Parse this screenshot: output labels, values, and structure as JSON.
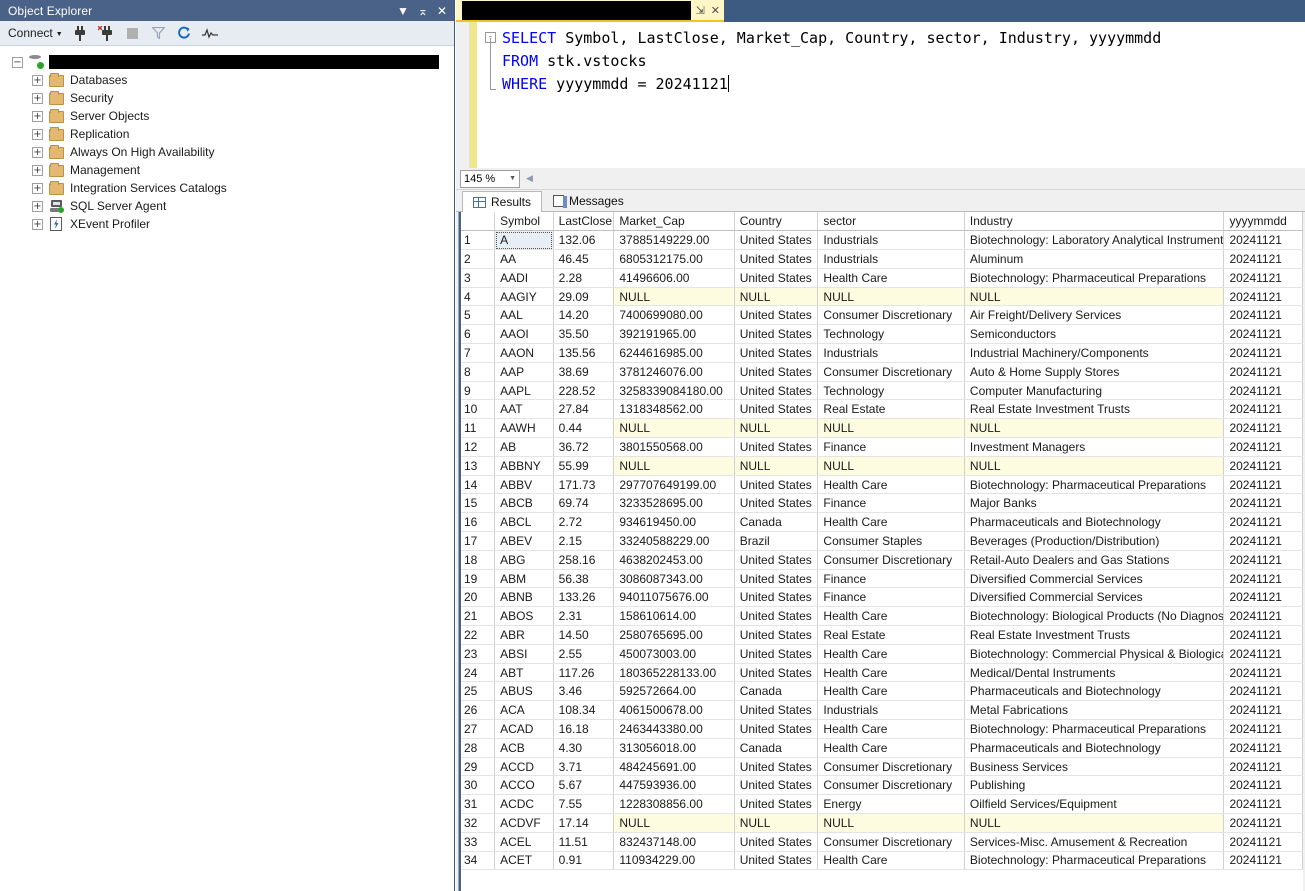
{
  "object_explorer": {
    "title": "Object Explorer",
    "window_buttons": [
      "dropdown-caret",
      "pin",
      "close"
    ],
    "toolbar": {
      "connect_label": "Connect",
      "icons": [
        "connect-plug-icon",
        "disconnect-plug-icon",
        "stop-icon",
        "filter-icon",
        "refresh-icon",
        "activity-monitor-icon"
      ]
    },
    "tree": {
      "server_label": "",
      "server_redacted": true,
      "items": [
        {
          "label": "Databases",
          "icon": "folder-icon"
        },
        {
          "label": "Security",
          "icon": "folder-icon"
        },
        {
          "label": "Server Objects",
          "icon": "folder-icon"
        },
        {
          "label": "Replication",
          "icon": "folder-icon"
        },
        {
          "label": "Always On High Availability",
          "icon": "folder-icon"
        },
        {
          "label": "Management",
          "icon": "folder-icon"
        },
        {
          "label": "Integration Services Catalogs",
          "icon": "folder-icon"
        },
        {
          "label": "SQL Server Agent",
          "icon": "sql-agent-icon"
        },
        {
          "label": "XEvent Profiler",
          "icon": "xevent-icon"
        }
      ]
    }
  },
  "editor": {
    "tab": {
      "title_redacted": true,
      "pin_label": "⇲",
      "close_label": "✕"
    },
    "query_lines": [
      {
        "collapse": "-",
        "tokens": [
          {
            "t": "SELECT",
            "k": "kw"
          },
          {
            "t": " Symbol, LastClose, Market_Cap, Country, sector, Industry, yyyymmdd",
            "k": "plain"
          }
        ]
      },
      {
        "collapse": "",
        "tokens": [
          {
            "t": "FROM",
            "k": "kw"
          },
          {
            "t": " stk.vstocks",
            "k": "plain"
          }
        ]
      },
      {
        "collapse": "",
        "tokens": [
          {
            "t": "WHERE",
            "k": "kw"
          },
          {
            "t": " yyyymmdd = ",
            "k": "plain"
          },
          {
            "t": "20241121",
            "k": "num"
          }
        ]
      }
    ],
    "zoom_level": "145 %"
  },
  "results": {
    "tabs": [
      {
        "label": "Results",
        "icon": "grid-icon",
        "active": true
      },
      {
        "label": "Messages",
        "icon": "messages-icon",
        "active": false
      }
    ],
    "columns": [
      "Symbol",
      "LastClose",
      "Market_Cap",
      "Country",
      "sector",
      "Industry",
      "yyyymmdd"
    ],
    "null_text": "NULL",
    "rows": [
      {
        "n": "1",
        "Symbol": "A",
        "LastClose": "132.06",
        "Market_Cap": "37885149229.00",
        "Country": "United States",
        "sector": "Industrials",
        "Industry": "Biotechnology: Laboratory Analytical Instruments",
        "yyyymmdd": "20241121"
      },
      {
        "n": "2",
        "Symbol": "AA",
        "LastClose": "46.45",
        "Market_Cap": "6805312175.00",
        "Country": "United States",
        "sector": "Industrials",
        "Industry": "Aluminum",
        "yyyymmdd": "20241121"
      },
      {
        "n": "3",
        "Symbol": "AADI",
        "LastClose": "2.28",
        "Market_Cap": "41496606.00",
        "Country": "United States",
        "sector": "Health Care",
        "Industry": "Biotechnology: Pharmaceutical Preparations",
        "yyyymmdd": "20241121"
      },
      {
        "n": "4",
        "Symbol": "AAGIY",
        "LastClose": "29.09",
        "Market_Cap": "NULL",
        "Country": "NULL",
        "sector": "NULL",
        "Industry": "NULL",
        "yyyymmdd": "20241121"
      },
      {
        "n": "5",
        "Symbol": "AAL",
        "LastClose": "14.20",
        "Market_Cap": "7400699080.00",
        "Country": "United States",
        "sector": "Consumer Discretionary",
        "Industry": "Air Freight/Delivery Services",
        "yyyymmdd": "20241121"
      },
      {
        "n": "6",
        "Symbol": "AAOI",
        "LastClose": "35.50",
        "Market_Cap": "392191965.00",
        "Country": "United States",
        "sector": "Technology",
        "Industry": "Semiconductors",
        "yyyymmdd": "20241121"
      },
      {
        "n": "7",
        "Symbol": "AAON",
        "LastClose": "135.56",
        "Market_Cap": "6244616985.00",
        "Country": "United States",
        "sector": "Industrials",
        "Industry": "Industrial Machinery/Components",
        "yyyymmdd": "20241121"
      },
      {
        "n": "8",
        "Symbol": "AAP",
        "LastClose": "38.69",
        "Market_Cap": "3781246076.00",
        "Country": "United States",
        "sector": "Consumer Discretionary",
        "Industry": "Auto & Home Supply Stores",
        "yyyymmdd": "20241121"
      },
      {
        "n": "9",
        "Symbol": "AAPL",
        "LastClose": "228.52",
        "Market_Cap": "3258339084180.00",
        "Country": "United States",
        "sector": "Technology",
        "Industry": "Computer Manufacturing",
        "yyyymmdd": "20241121"
      },
      {
        "n": "10",
        "Symbol": "AAT",
        "LastClose": "27.84",
        "Market_Cap": "1318348562.00",
        "Country": "United States",
        "sector": "Real Estate",
        "Industry": "Real Estate Investment Trusts",
        "yyyymmdd": "20241121"
      },
      {
        "n": "11",
        "Symbol": "AAWH",
        "LastClose": "0.44",
        "Market_Cap": "NULL",
        "Country": "NULL",
        "sector": "NULL",
        "Industry": "NULL",
        "yyyymmdd": "20241121"
      },
      {
        "n": "12",
        "Symbol": "AB",
        "LastClose": "36.72",
        "Market_Cap": "3801550568.00",
        "Country": "United States",
        "sector": "Finance",
        "Industry": "Investment Managers",
        "yyyymmdd": "20241121"
      },
      {
        "n": "13",
        "Symbol": "ABBNY",
        "LastClose": "55.99",
        "Market_Cap": "NULL",
        "Country": "NULL",
        "sector": "NULL",
        "Industry": "NULL",
        "yyyymmdd": "20241121"
      },
      {
        "n": "14",
        "Symbol": "ABBV",
        "LastClose": "171.73",
        "Market_Cap": "297707649199.00",
        "Country": "United States",
        "sector": "Health Care",
        "Industry": "Biotechnology: Pharmaceutical Preparations",
        "yyyymmdd": "20241121"
      },
      {
        "n": "15",
        "Symbol": "ABCB",
        "LastClose": "69.74",
        "Market_Cap": "3233528695.00",
        "Country": "United States",
        "sector": "Finance",
        "Industry": "Major Banks",
        "yyyymmdd": "20241121"
      },
      {
        "n": "16",
        "Symbol": "ABCL",
        "LastClose": "2.72",
        "Market_Cap": "934619450.00",
        "Country": "Canada",
        "sector": "Health Care",
        "Industry": "Pharmaceuticals and Biotechnology",
        "yyyymmdd": "20241121"
      },
      {
        "n": "17",
        "Symbol": "ABEV",
        "LastClose": "2.15",
        "Market_Cap": "33240588229.00",
        "Country": "Brazil",
        "sector": "Consumer Staples",
        "Industry": "Beverages (Production/Distribution)",
        "yyyymmdd": "20241121"
      },
      {
        "n": "18",
        "Symbol": "ABG",
        "LastClose": "258.16",
        "Market_Cap": "4638202453.00",
        "Country": "United States",
        "sector": "Consumer Discretionary",
        "Industry": "Retail-Auto Dealers and Gas Stations",
        "yyyymmdd": "20241121"
      },
      {
        "n": "19",
        "Symbol": "ABM",
        "LastClose": "56.38",
        "Market_Cap": "3086087343.00",
        "Country": "United States",
        "sector": "Finance",
        "Industry": "Diversified Commercial Services",
        "yyyymmdd": "20241121"
      },
      {
        "n": "20",
        "Symbol": "ABNB",
        "LastClose": "133.26",
        "Market_Cap": "94011075676.00",
        "Country": "United States",
        "sector": "Finance",
        "Industry": "Diversified Commercial Services",
        "yyyymmdd": "20241121"
      },
      {
        "n": "21",
        "Symbol": "ABOS",
        "LastClose": "2.31",
        "Market_Cap": "158610614.00",
        "Country": "United States",
        "sector": "Health Care",
        "Industry": "Biotechnology: Biological Products (No Diagnosti...",
        "yyyymmdd": "20241121"
      },
      {
        "n": "22",
        "Symbol": "ABR",
        "LastClose": "14.50",
        "Market_Cap": "2580765695.00",
        "Country": "United States",
        "sector": "Real Estate",
        "Industry": "Real Estate Investment Trusts",
        "yyyymmdd": "20241121"
      },
      {
        "n": "23",
        "Symbol": "ABSI",
        "LastClose": "2.55",
        "Market_Cap": "450073003.00",
        "Country": "United States",
        "sector": "Health Care",
        "Industry": "Biotechnology: Commercial Physical & Biological ...",
        "yyyymmdd": "20241121"
      },
      {
        "n": "24",
        "Symbol": "ABT",
        "LastClose": "117.26",
        "Market_Cap": "180365228133.00",
        "Country": "United States",
        "sector": "Health Care",
        "Industry": "Medical/Dental Instruments",
        "yyyymmdd": "20241121"
      },
      {
        "n": "25",
        "Symbol": "ABUS",
        "LastClose": "3.46",
        "Market_Cap": "592572664.00",
        "Country": "Canada",
        "sector": "Health Care",
        "Industry": "Pharmaceuticals and Biotechnology",
        "yyyymmdd": "20241121"
      },
      {
        "n": "26",
        "Symbol": "ACA",
        "LastClose": "108.34",
        "Market_Cap": "4061500678.00",
        "Country": "United States",
        "sector": "Industrials",
        "Industry": "Metal Fabrications",
        "yyyymmdd": "20241121"
      },
      {
        "n": "27",
        "Symbol": "ACAD",
        "LastClose": "16.18",
        "Market_Cap": "2463443380.00",
        "Country": "United States",
        "sector": "Health Care",
        "Industry": "Biotechnology: Pharmaceutical Preparations",
        "yyyymmdd": "20241121"
      },
      {
        "n": "28",
        "Symbol": "ACB",
        "LastClose": "4.30",
        "Market_Cap": "313056018.00",
        "Country": "Canada",
        "sector": "Health Care",
        "Industry": "Pharmaceuticals and Biotechnology",
        "yyyymmdd": "20241121"
      },
      {
        "n": "29",
        "Symbol": "ACCD",
        "LastClose": "3.71",
        "Market_Cap": "484245691.00",
        "Country": "United States",
        "sector": "Consumer Discretionary",
        "Industry": "Business Services",
        "yyyymmdd": "20241121"
      },
      {
        "n": "30",
        "Symbol": "ACCO",
        "LastClose": "5.67",
        "Market_Cap": "447593936.00",
        "Country": "United States",
        "sector": "Consumer Discretionary",
        "Industry": "Publishing",
        "yyyymmdd": "20241121"
      },
      {
        "n": "31",
        "Symbol": "ACDC",
        "LastClose": "7.55",
        "Market_Cap": "1228308856.00",
        "Country": "United States",
        "sector": "Energy",
        "Industry": "Oilfield Services/Equipment",
        "yyyymmdd": "20241121"
      },
      {
        "n": "32",
        "Symbol": "ACDVF",
        "LastClose": "17.14",
        "Market_Cap": "NULL",
        "Country": "NULL",
        "sector": "NULL",
        "Industry": "NULL",
        "yyyymmdd": "20241121"
      },
      {
        "n": "33",
        "Symbol": "ACEL",
        "LastClose": "11.51",
        "Market_Cap": "832437148.00",
        "Country": "United States",
        "sector": "Consumer Discretionary",
        "Industry": "Services-Misc. Amusement & Recreation",
        "yyyymmdd": "20241121"
      },
      {
        "n": "34",
        "Symbol": "ACET",
        "LastClose": "0.91",
        "Market_Cap": "110934229.00",
        "Country": "United States",
        "sector": "Health Care",
        "Industry": "Biotechnology: Pharmaceutical Preparations",
        "yyyymmdd": "20241121"
      }
    ]
  },
  "colors": {
    "titlebar": "#4a6287",
    "tab_accent": "#f0c419",
    "null_cell": "#fdfbe0",
    "keyword": "#0000ff"
  }
}
